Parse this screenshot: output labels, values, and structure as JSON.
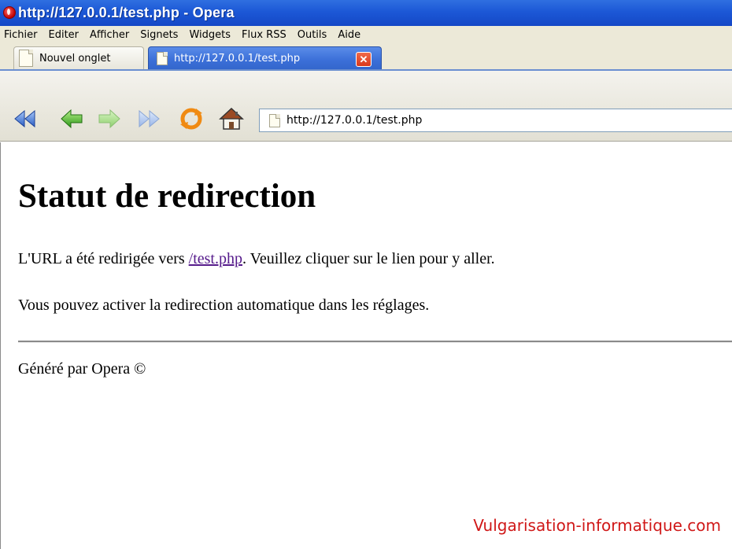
{
  "window": {
    "title": "http://127.0.0.1/test.php - Opera"
  },
  "menu": {
    "items": [
      {
        "label": "Fichier"
      },
      {
        "label": "Editer"
      },
      {
        "label": "Afficher"
      },
      {
        "label": "Signets"
      },
      {
        "label": "Widgets"
      },
      {
        "label": "Flux RSS"
      },
      {
        "label": "Outils"
      },
      {
        "label": "Aide"
      }
    ]
  },
  "tabs": [
    {
      "label": "Nouvel onglet",
      "active": false
    },
    {
      "label": "http://127.0.0.1/test.php",
      "active": true
    }
  ],
  "toolbar": {
    "address": "http://127.0.0.1/test.php",
    "buttons": [
      "rewind-icon",
      "back-icon",
      "forward-icon",
      "fast-forward-icon",
      "reload-icon",
      "home-icon"
    ]
  },
  "page": {
    "heading": "Statut de redirection",
    "redirect_before": "L'URL a été redirigée vers ",
    "redirect_link": "/test.php",
    "redirect_after": ". Veuillez cliquer sur le lien pour y aller.",
    "settings_text": "Vous pouvez activer la redirection automatique dans les réglages.",
    "footer": "Généré par Opera ©"
  },
  "watermark": "Vulgarisation-informatique.com",
  "colors": {
    "titlebar": "#1c58d6",
    "link": "#551a8b",
    "watermark": "#d01818"
  }
}
